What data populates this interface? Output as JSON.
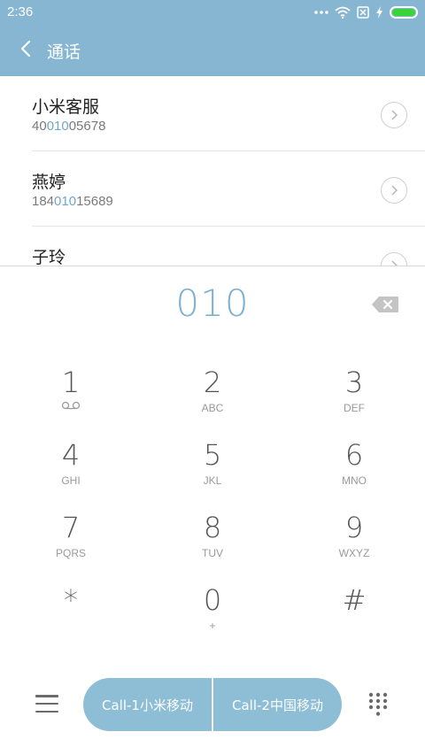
{
  "status_bar": {
    "time": "2:36",
    "icons": [
      "more-dots-icon",
      "wifi-icon",
      "sim-disabled-icon",
      "charging-icon",
      "battery-icon"
    ],
    "battery_color": "#38d438"
  },
  "header": {
    "title": "通话",
    "background": "#86b6d1"
  },
  "results": [
    {
      "name": "小米客服",
      "number_pre": "40",
      "number_match": "010",
      "number_post": "05678"
    },
    {
      "name": "燕婷",
      "number_pre": "184",
      "number_match": "010",
      "number_post": "15689"
    },
    {
      "name": "子玲"
    }
  ],
  "dialer": {
    "dialed_number": "010",
    "accent_color": "#7fb1cf"
  },
  "keypad": [
    {
      "digit": "1",
      "letters": ""
    },
    {
      "digit": "2",
      "letters": "ABC"
    },
    {
      "digit": "3",
      "letters": "DEF"
    },
    {
      "digit": "4",
      "letters": "GHI"
    },
    {
      "digit": "5",
      "letters": "JKL"
    },
    {
      "digit": "6",
      "letters": "MNO"
    },
    {
      "digit": "7",
      "letters": "PQRS"
    },
    {
      "digit": "8",
      "letters": "TUV"
    },
    {
      "digit": "9",
      "letters": "WXYZ"
    },
    {
      "digit": "*",
      "letters": ""
    },
    {
      "digit": "0",
      "letters": "+"
    },
    {
      "digit": "#",
      "letters": ""
    }
  ],
  "bottom_bar": {
    "call1_label": "Call-1小米移动",
    "call2_label": "Call-2中国移动",
    "call_button_color": "#8ebdd6"
  }
}
